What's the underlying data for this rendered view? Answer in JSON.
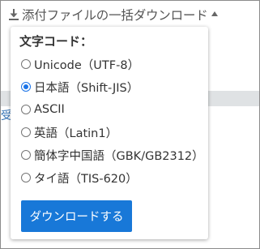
{
  "toolbar": {
    "download_label": "添付ファイルの一括ダウンロード",
    "download_icon": "download-icon",
    "caret_icon": "caret-up-icon"
  },
  "background": {
    "partial_text": "受"
  },
  "popup": {
    "title": "文字コード：",
    "options": [
      {
        "label": "Unicode（UTF-8）",
        "checked": false
      },
      {
        "label": "日本語（Shift-JIS）",
        "checked": true
      },
      {
        "label": "ASCII",
        "checked": false
      },
      {
        "label": "英語（Latin1）",
        "checked": false
      },
      {
        "label": "簡体字中国語（GBK/GB2312）",
        "checked": false
      },
      {
        "label": "タイ語（TIS-620）",
        "checked": false
      }
    ],
    "download_button": "ダウンロードする"
  },
  "colors": {
    "accent": "#1878d8",
    "link_text": "#2f6fb3",
    "band": "#dfe2e4"
  }
}
